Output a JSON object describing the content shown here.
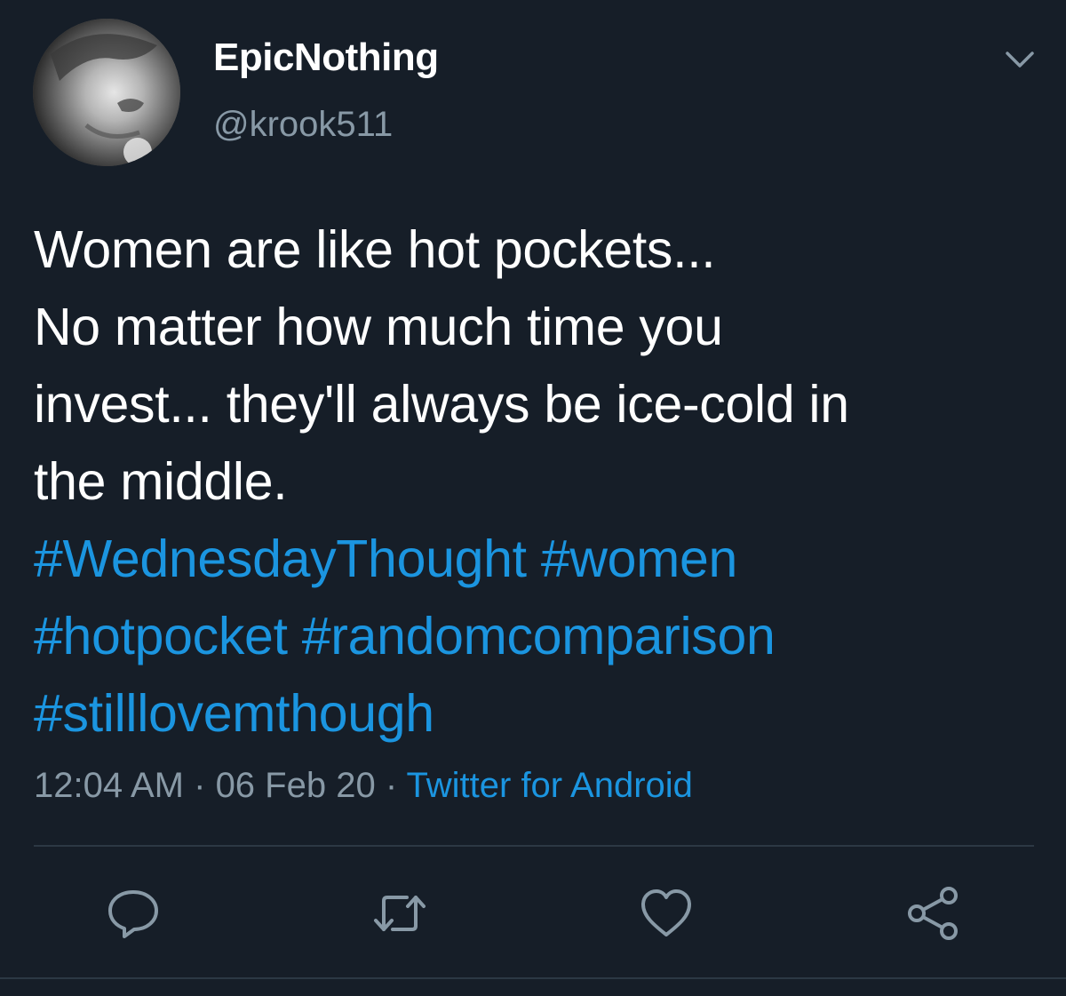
{
  "tweet": {
    "author": {
      "display_name": "EpicNothing",
      "handle": "@krook511"
    },
    "text_lines": [
      "Women are like hot pockets...",
      "No matter how much time you",
      "invest... they'll always be ice-cold in",
      "the middle."
    ],
    "hashtags": {
      "h1": "#WednesdayThought",
      "h2": "#women",
      "h3": "#hotpocket",
      "h4": "#randomcomparison",
      "h5": "#stilllovemthough"
    },
    "meta": {
      "time": "12:04 AM",
      "sep1": " · ",
      "date": "06 Feb 20",
      "sep2": " · ",
      "source": "Twitter for Android"
    },
    "actions": {
      "reply_icon": "reply-icon",
      "retweet_icon": "retweet-icon",
      "like_icon": "heart-icon",
      "share_icon": "share-icon"
    },
    "colors": {
      "background": "#161e28",
      "hashtag": "#1b95e0",
      "secondary_text": "#8899a6"
    }
  }
}
